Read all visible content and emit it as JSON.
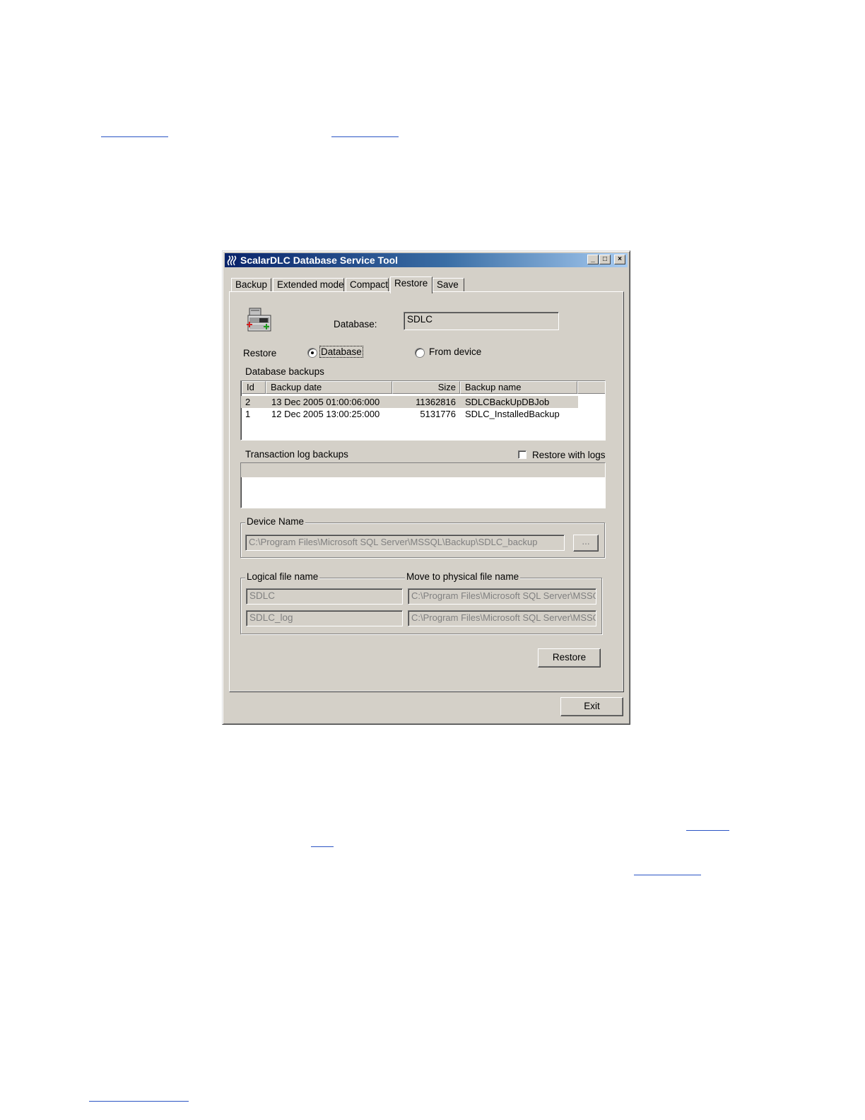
{
  "window": {
    "title": "ScalarDLC Database Service Tool",
    "minimize_symbol": "_",
    "maximize_symbol": "□",
    "close_symbol": "×"
  },
  "tabs": [
    {
      "label": "Backup",
      "active": false
    },
    {
      "label": "Extended mode",
      "active": false
    },
    {
      "label": "Compact",
      "active": false
    },
    {
      "label": "Restore",
      "active": true
    },
    {
      "label": "Save",
      "active": false
    }
  ],
  "restore": {
    "database_label": "Database:",
    "database_value": "SDLC",
    "restore_label": "Restore",
    "radio_database": "Database",
    "radio_from_device": "From device",
    "selected_source": "Database",
    "db_backups_label": "Database backups",
    "db_backups_columns": [
      "Id",
      "Backup date",
      "Size",
      "Backup name"
    ],
    "db_backups_rows": [
      {
        "id": "2",
        "date": "13 Dec 2005 01:00:06:000",
        "size": "11362816",
        "name": "SDLCBackUpDBJob",
        "selected": true
      },
      {
        "id": "1",
        "date": "12 Dec 2005 13:00:25:000",
        "size": "5131776",
        "name": "SDLC_InstalledBackup",
        "selected": false
      }
    ],
    "tlog_label": "Transaction log backups",
    "restore_with_logs_label": "Restore with logs",
    "restore_with_logs_checked": false,
    "device_group_label": "Device Name",
    "device_path": "C:\\Program Files\\Microsoft SQL Server\\MSSQL\\Backup\\SDLC_backup",
    "browse_label": "...",
    "logical_label": "Logical file name",
    "physical_label": "Move to physical file name",
    "files": [
      {
        "logical": "SDLC",
        "physical": "C:\\Program Files\\Microsoft SQL Server\\MSSQ"
      },
      {
        "logical": "SDLC_log",
        "physical": "C:\\Program Files\\Microsoft SQL Server\\MSSQ"
      }
    ],
    "restore_button": "Restore"
  },
  "footer": {
    "exit_button": "Exit"
  },
  "colors": {
    "title_gradient_start": "#0a246a",
    "title_gradient_end": "#a6caf0",
    "dialog_face": "#d4d0c8",
    "link_underline": "#2a54c4"
  }
}
